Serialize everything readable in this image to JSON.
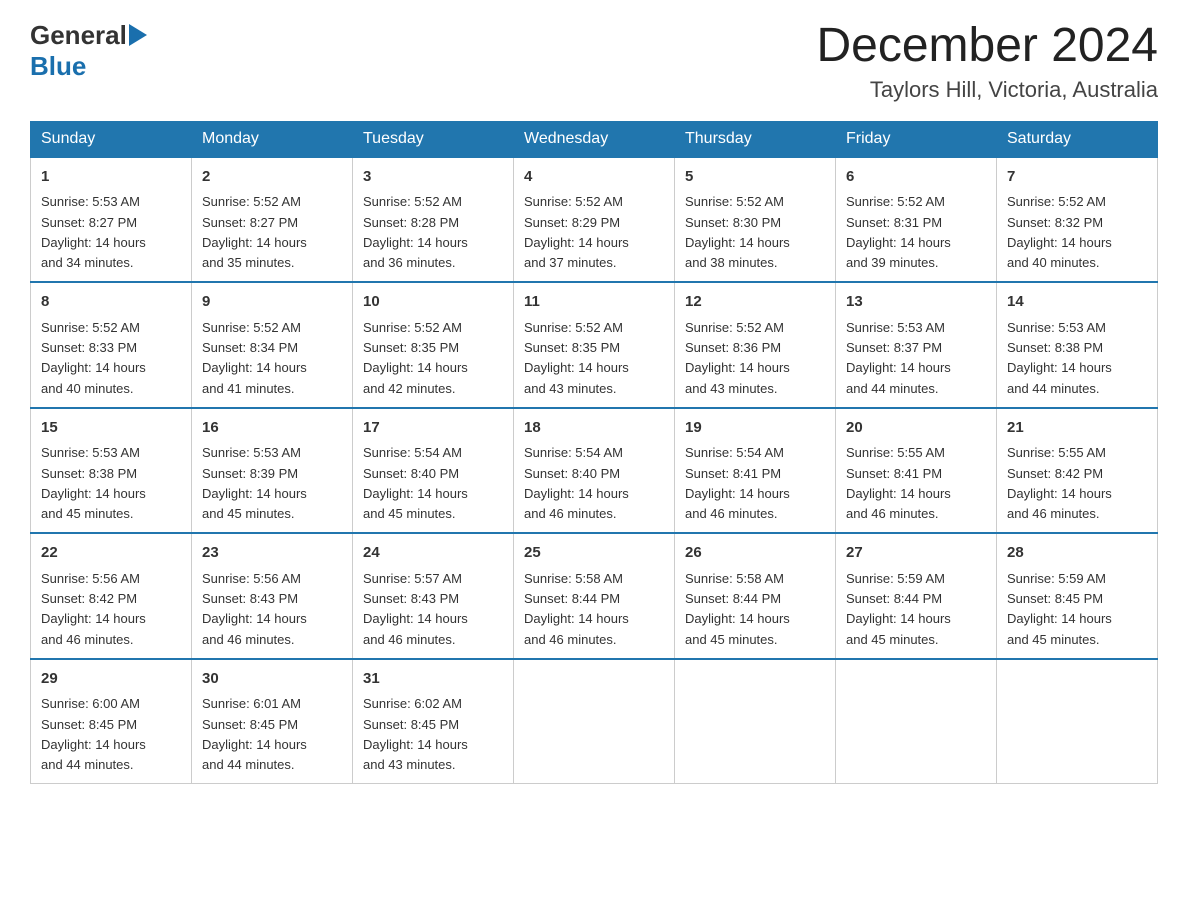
{
  "logo": {
    "general": "General",
    "blue": "Blue"
  },
  "title": "December 2024",
  "subtitle": "Taylors Hill, Victoria, Australia",
  "weekdays": [
    "Sunday",
    "Monday",
    "Tuesday",
    "Wednesday",
    "Thursday",
    "Friday",
    "Saturday"
  ],
  "weeks": [
    [
      {
        "day": "1",
        "sunrise": "5:53 AM",
        "sunset": "8:27 PM",
        "daylight": "14 hours and 34 minutes."
      },
      {
        "day": "2",
        "sunrise": "5:52 AM",
        "sunset": "8:27 PM",
        "daylight": "14 hours and 35 minutes."
      },
      {
        "day": "3",
        "sunrise": "5:52 AM",
        "sunset": "8:28 PM",
        "daylight": "14 hours and 36 minutes."
      },
      {
        "day": "4",
        "sunrise": "5:52 AM",
        "sunset": "8:29 PM",
        "daylight": "14 hours and 37 minutes."
      },
      {
        "day": "5",
        "sunrise": "5:52 AM",
        "sunset": "8:30 PM",
        "daylight": "14 hours and 38 minutes."
      },
      {
        "day": "6",
        "sunrise": "5:52 AM",
        "sunset": "8:31 PM",
        "daylight": "14 hours and 39 minutes."
      },
      {
        "day": "7",
        "sunrise": "5:52 AM",
        "sunset": "8:32 PM",
        "daylight": "14 hours and 40 minutes."
      }
    ],
    [
      {
        "day": "8",
        "sunrise": "5:52 AM",
        "sunset": "8:33 PM",
        "daylight": "14 hours and 40 minutes."
      },
      {
        "day": "9",
        "sunrise": "5:52 AM",
        "sunset": "8:34 PM",
        "daylight": "14 hours and 41 minutes."
      },
      {
        "day": "10",
        "sunrise": "5:52 AM",
        "sunset": "8:35 PM",
        "daylight": "14 hours and 42 minutes."
      },
      {
        "day": "11",
        "sunrise": "5:52 AM",
        "sunset": "8:35 PM",
        "daylight": "14 hours and 43 minutes."
      },
      {
        "day": "12",
        "sunrise": "5:52 AM",
        "sunset": "8:36 PM",
        "daylight": "14 hours and 43 minutes."
      },
      {
        "day": "13",
        "sunrise": "5:53 AM",
        "sunset": "8:37 PM",
        "daylight": "14 hours and 44 minutes."
      },
      {
        "day": "14",
        "sunrise": "5:53 AM",
        "sunset": "8:38 PM",
        "daylight": "14 hours and 44 minutes."
      }
    ],
    [
      {
        "day": "15",
        "sunrise": "5:53 AM",
        "sunset": "8:38 PM",
        "daylight": "14 hours and 45 minutes."
      },
      {
        "day": "16",
        "sunrise": "5:53 AM",
        "sunset": "8:39 PM",
        "daylight": "14 hours and 45 minutes."
      },
      {
        "day": "17",
        "sunrise": "5:54 AM",
        "sunset": "8:40 PM",
        "daylight": "14 hours and 45 minutes."
      },
      {
        "day": "18",
        "sunrise": "5:54 AM",
        "sunset": "8:40 PM",
        "daylight": "14 hours and 46 minutes."
      },
      {
        "day": "19",
        "sunrise": "5:54 AM",
        "sunset": "8:41 PM",
        "daylight": "14 hours and 46 minutes."
      },
      {
        "day": "20",
        "sunrise": "5:55 AM",
        "sunset": "8:41 PM",
        "daylight": "14 hours and 46 minutes."
      },
      {
        "day": "21",
        "sunrise": "5:55 AM",
        "sunset": "8:42 PM",
        "daylight": "14 hours and 46 minutes."
      }
    ],
    [
      {
        "day": "22",
        "sunrise": "5:56 AM",
        "sunset": "8:42 PM",
        "daylight": "14 hours and 46 minutes."
      },
      {
        "day": "23",
        "sunrise": "5:56 AM",
        "sunset": "8:43 PM",
        "daylight": "14 hours and 46 minutes."
      },
      {
        "day": "24",
        "sunrise": "5:57 AM",
        "sunset": "8:43 PM",
        "daylight": "14 hours and 46 minutes."
      },
      {
        "day": "25",
        "sunrise": "5:58 AM",
        "sunset": "8:44 PM",
        "daylight": "14 hours and 46 minutes."
      },
      {
        "day": "26",
        "sunrise": "5:58 AM",
        "sunset": "8:44 PM",
        "daylight": "14 hours and 45 minutes."
      },
      {
        "day": "27",
        "sunrise": "5:59 AM",
        "sunset": "8:44 PM",
        "daylight": "14 hours and 45 minutes."
      },
      {
        "day": "28",
        "sunrise": "5:59 AM",
        "sunset": "8:45 PM",
        "daylight": "14 hours and 45 minutes."
      }
    ],
    [
      {
        "day": "29",
        "sunrise": "6:00 AM",
        "sunset": "8:45 PM",
        "daylight": "14 hours and 44 minutes."
      },
      {
        "day": "30",
        "sunrise": "6:01 AM",
        "sunset": "8:45 PM",
        "daylight": "14 hours and 44 minutes."
      },
      {
        "day": "31",
        "sunrise": "6:02 AM",
        "sunset": "8:45 PM",
        "daylight": "14 hours and 43 minutes."
      },
      null,
      null,
      null,
      null
    ]
  ],
  "labels": {
    "sunrise": "Sunrise:",
    "sunset": "Sunset:",
    "daylight": "Daylight:"
  }
}
